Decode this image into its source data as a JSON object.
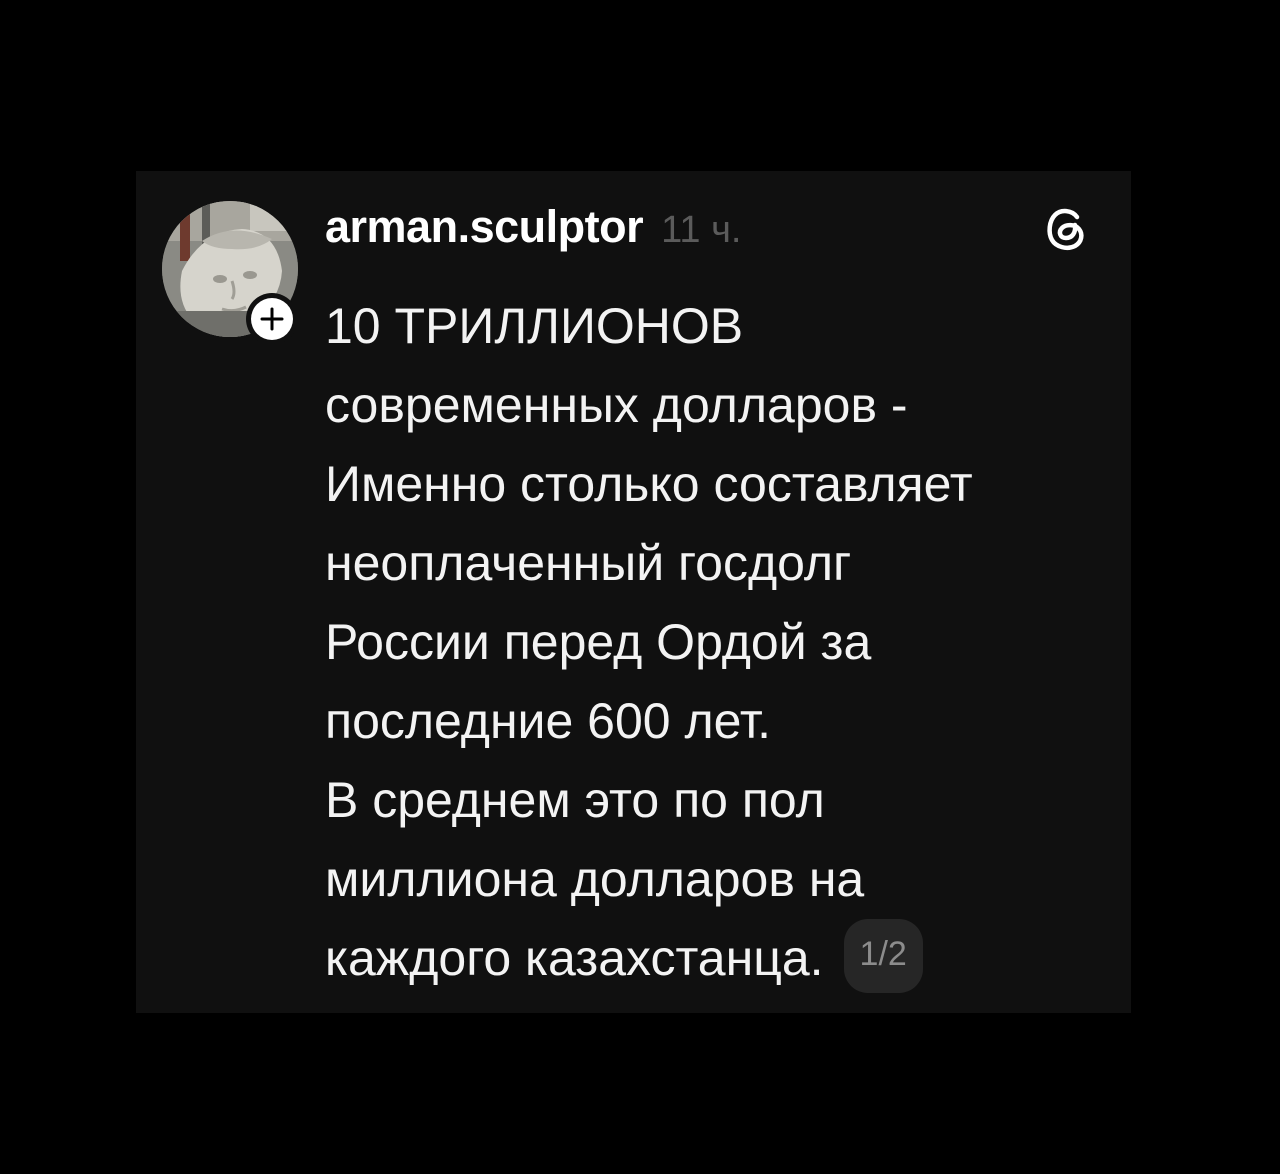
{
  "post": {
    "username": "arman.sculptor",
    "timestamp": "11 ч.",
    "follow_icon": "plus-icon",
    "app_icon": "threads-logo-icon",
    "lines": [
      "10 ТРИЛЛИОНОВ",
      "современных долларов -",
      "Именно столько составляет",
      "неоплаченный госдолг",
      "России перед Ордой за",
      "последние 600 лет.",
      "В среднем это по пол",
      "миллиона долларов на",
      "каждого казахстанца."
    ],
    "page_indicator": "1/2"
  },
  "colors": {
    "background": "#000000",
    "card": "#101010",
    "text": "#f3f3f3",
    "muted": "#5b5b5b",
    "badge": "#262626"
  }
}
